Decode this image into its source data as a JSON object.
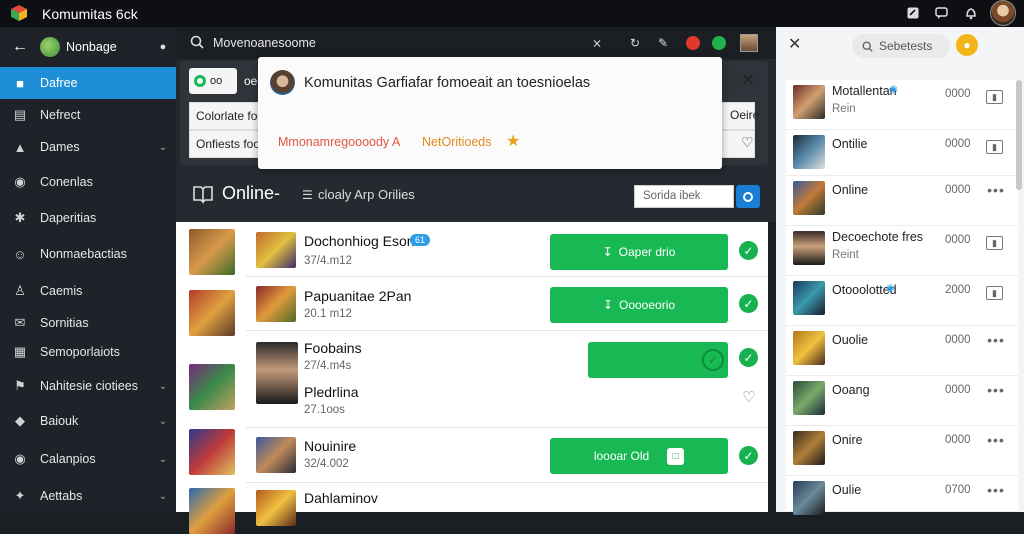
{
  "window": {
    "title": "Komumitas 6ck"
  },
  "toolbar": {
    "search_text": "Movenoanesoome"
  },
  "sidebar": {
    "profile_label": "Nonbage",
    "items": [
      {
        "label": "Dafree",
        "icon": "home-icon",
        "active": true,
        "chevron": false
      },
      {
        "label": "Nefrect",
        "icon": "list-icon",
        "active": false,
        "chevron": false
      },
      {
        "label": "Dames",
        "icon": "chart-icon",
        "active": false,
        "chevron": true
      },
      {
        "label": "Conenlas",
        "icon": "camera-icon",
        "active": false,
        "chevron": false
      },
      {
        "label": "Daperitias",
        "icon": "star-icon",
        "active": false,
        "chevron": false
      },
      {
        "label": "Nonmaebactias",
        "icon": "user-icon",
        "active": false,
        "chevron": false
      },
      {
        "label": "Caemis",
        "icon": "person-icon",
        "active": false,
        "chevron": false
      },
      {
        "label": "Sornitias",
        "icon": "mail-icon",
        "active": false,
        "chevron": false
      },
      {
        "label": "Semoporlaiots",
        "icon": "grid-icon",
        "active": false,
        "chevron": false
      },
      {
        "label": "Nahitesie ciotiees",
        "icon": "flag-icon",
        "active": false,
        "chevron": true
      },
      {
        "label": "Baiouk",
        "icon": "shield-icon",
        "active": false,
        "chevron": true
      },
      {
        "label": "Calanpios",
        "icon": "globe-icon",
        "active": false,
        "chevron": true
      },
      {
        "label": "Aettabs",
        "icon": "tools-icon",
        "active": false,
        "chevron": true
      }
    ]
  },
  "pinned": {
    "badge": "oo",
    "badge_label": "oe",
    "row1": "Colorlate foo",
    "row2": "Onfiests foo",
    "side1": "Oeire",
    "side2": "ooo"
  },
  "notification": {
    "message": "Komunitas Garfiafar fomoeait an toesnioelas",
    "sub_red": "Mmonamregoooody A",
    "sub_orange": "NetOritioeds"
  },
  "online": {
    "title": "Online-",
    "subtitle": "cloaly Arp Orilies",
    "search_placeholder": "Sorida ibek"
  },
  "games": [
    {
      "name": "Dochonhiog Eson",
      "size": "37/4.m12",
      "badge": "61",
      "button": "Oaper drio",
      "button_icon": "download",
      "status": "check"
    },
    {
      "name": "Papuanitae 2Pan",
      "size": "20.1 m12",
      "button": "Ooooeorio",
      "button_icon": "download",
      "status": "check"
    },
    {
      "name": "Foobains",
      "size": "27/4.m4s",
      "button": "",
      "button_icon": "check",
      "status": "check"
    },
    {
      "name": "Pledrlina",
      "size": "27.1oos",
      "button": "",
      "button_icon": "",
      "status": "heart"
    },
    {
      "name": "Nouinire",
      "size": "32/4.002",
      "button": "loooar Old",
      "button_icon": "box",
      "status": "check"
    },
    {
      "name": "Dahlaminov",
      "size": "",
      "button": "",
      "button_icon": "",
      "status": "none"
    }
  ],
  "right_panel": {
    "search_label": "Sebetests",
    "items": [
      {
        "name": "Motallentan",
        "sub": "Rein",
        "num": "0000",
        "action": "box",
        "verified": true
      },
      {
        "name": "Ontilie",
        "sub": "",
        "num": "0000",
        "action": "box",
        "verified": false
      },
      {
        "name": "Online",
        "sub": "",
        "num": "0000",
        "action": "more",
        "verified": false
      },
      {
        "name": "Decoechote fres",
        "sub": "Reint",
        "num": "0000",
        "action": "box",
        "verified": false
      },
      {
        "name": "Otooolotted",
        "sub": "",
        "num": "2000",
        "action": "box",
        "verified": true
      },
      {
        "name": "Ouolie",
        "sub": "",
        "num": "0000",
        "action": "more",
        "verified": false
      },
      {
        "name": "Ooang",
        "sub": "",
        "num": "0000",
        "action": "more",
        "verified": false
      },
      {
        "name": "Onire",
        "sub": "",
        "num": "0000",
        "action": "more",
        "verified": false
      },
      {
        "name": "Oulie",
        "sub": "",
        "num": "0700",
        "action": "more",
        "verified": false
      }
    ]
  },
  "colors": {
    "accent": "#1e8fd6",
    "green": "#18b955",
    "coin": "#f3b418"
  }
}
